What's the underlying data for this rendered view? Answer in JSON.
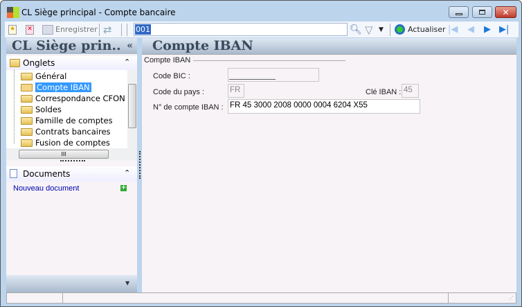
{
  "window": {
    "title": "CL Siège principal -  Compte bancaire"
  },
  "toolbar": {
    "save_label": "Enregistrer",
    "search_value": "001",
    "refresh_label": "Actualiser"
  },
  "left_panel": {
    "title": "CL Siège prin..",
    "collapse": "«",
    "onglets_label": "Onglets",
    "tabs": [
      {
        "label": "Général"
      },
      {
        "label": "Compte IBAN",
        "selected": true
      },
      {
        "label": "Correspondance CFON"
      },
      {
        "label": "Soldes"
      },
      {
        "label": "Famille de comptes"
      },
      {
        "label": "Contrats bancaires"
      },
      {
        "label": "Fusion de comptes"
      }
    ],
    "documents_label": "Documents",
    "new_document": "Nouveau document"
  },
  "main": {
    "title": "Compte IBAN",
    "group_label": "Compte IBAN",
    "fields": {
      "bic_label": "Code BIC :",
      "bic_value": "",
      "pays_label": "Code du pays :",
      "pays_value": "FR",
      "cle_label": "Clé IBAN :",
      "cle_value": "45",
      "iban_label": "N° de compte IBAN :",
      "iban_value": "FR 45 3000 2008 0000 0004 6204 X55"
    }
  },
  "colors": {
    "selection": "#3399ff",
    "link": "#0000aa",
    "header_text": "#3a4a5c"
  }
}
